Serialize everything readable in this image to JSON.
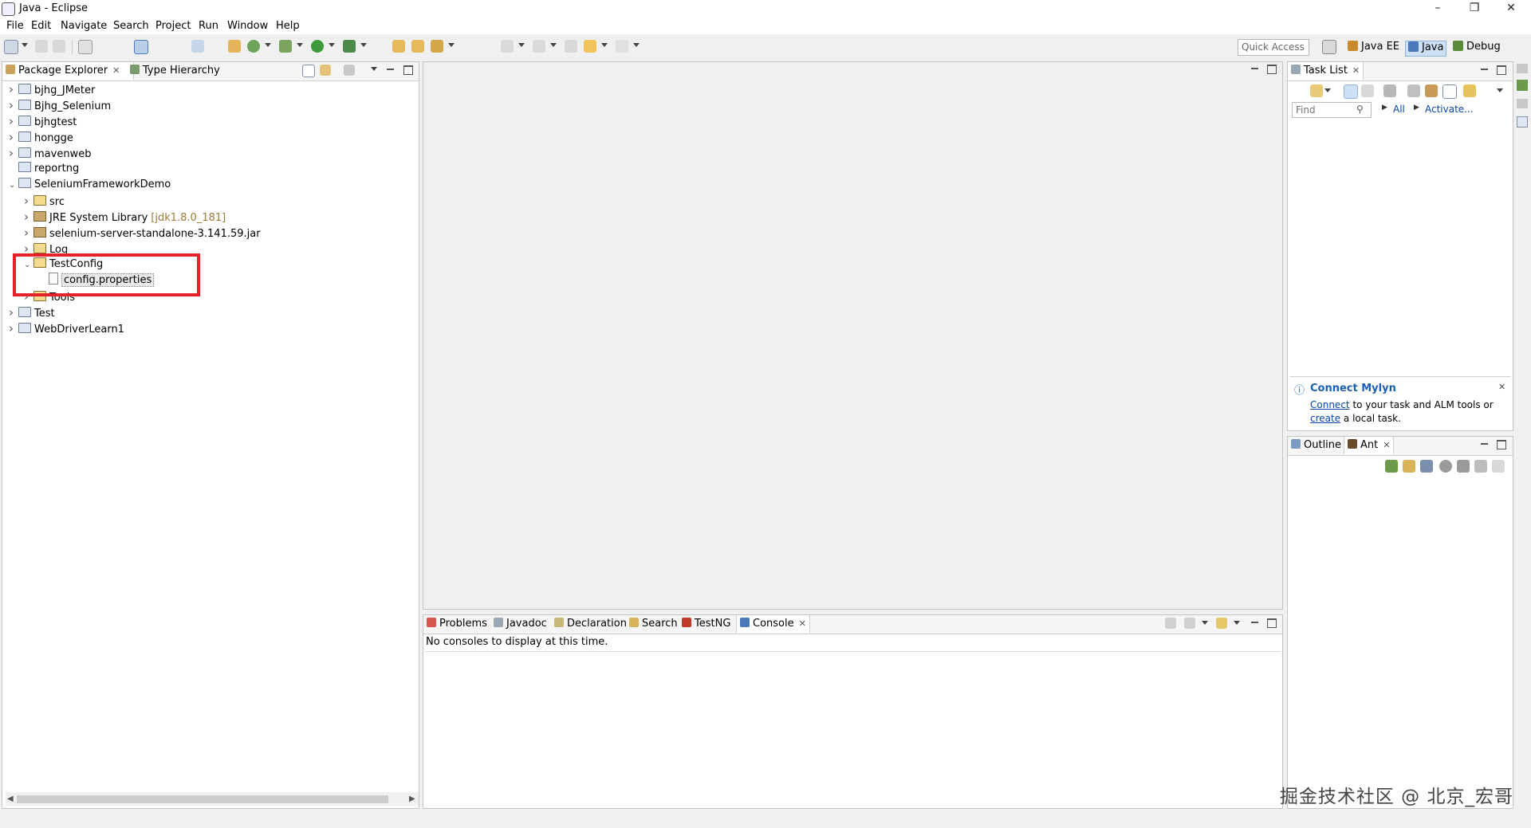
{
  "window": {
    "title": "Java - Eclipse",
    "minimize": "–",
    "restore": "❐",
    "close": "✕"
  },
  "menu": [
    "File",
    "Edit",
    "Navigate",
    "Search",
    "Project",
    "Run",
    "Window",
    "Help"
  ],
  "toolbar": {
    "quick_access": "Quick Access"
  },
  "perspectives": [
    {
      "label": "Java EE",
      "icon": "java-ee-icon",
      "color": "#c98a2a"
    },
    {
      "label": "Java",
      "icon": "java-icon",
      "color": "#4a78b8",
      "active": true
    },
    {
      "label": "Debug",
      "icon": "bug-icon",
      "color": "#5a8a3a"
    }
  ],
  "package_explorer": {
    "tabs": [
      {
        "label": "Package Explorer"
      },
      {
        "label": "Type Hierarchy"
      }
    ],
    "tree": [
      {
        "label": "bjhg_JMeter",
        "level": 0,
        "expanded": false,
        "icon": "project"
      },
      {
        "label": "Bjhg_Selenium",
        "level": 0,
        "expanded": false,
        "icon": "project"
      },
      {
        "label": "bjhgtest",
        "level": 0,
        "expanded": false,
        "icon": "project"
      },
      {
        "label": "hongge",
        "level": 0,
        "expanded": false,
        "icon": "project"
      },
      {
        "label": "mavenweb",
        "level": 0,
        "expanded": false,
        "icon": "project"
      },
      {
        "label": "reportng",
        "level": 0,
        "expanded": null,
        "icon": "project"
      },
      {
        "label": "SeleniumFrameworkDemo",
        "level": 0,
        "expanded": true,
        "icon": "project"
      },
      {
        "label": "src",
        "level": 1,
        "expanded": false,
        "icon": "folder"
      },
      {
        "label": "JRE System Library",
        "suffix": "[jdk1.8.0_181]",
        "level": 1,
        "expanded": false,
        "icon": "library"
      },
      {
        "label": "selenium-server-standalone-3.141.59.jar",
        "level": 1,
        "expanded": false,
        "icon": "jar"
      },
      {
        "label": "Log",
        "level": 1,
        "expanded": false,
        "icon": "folder"
      },
      {
        "label": "TestConfig",
        "level": 1,
        "expanded": true,
        "icon": "folder"
      },
      {
        "label": "config.properties",
        "level": 2,
        "expanded": null,
        "icon": "file",
        "selected": true
      },
      {
        "label": "Tools",
        "level": 1,
        "expanded": false,
        "icon": "folder"
      },
      {
        "label": "Test",
        "level": 0,
        "expanded": false,
        "icon": "project"
      },
      {
        "label": "WebDriverLearn1",
        "level": 0,
        "expanded": false,
        "icon": "project"
      }
    ]
  },
  "console_panel": {
    "tabs": [
      {
        "label": "Problems",
        "icon": "problems-icon"
      },
      {
        "label": "Javadoc",
        "icon": "at-icon"
      },
      {
        "label": "Declaration",
        "icon": "declaration-icon"
      },
      {
        "label": "Search",
        "icon": "search-icon"
      },
      {
        "label": "TestNG",
        "icon": "testng-icon"
      },
      {
        "label": "Console",
        "icon": "console-icon",
        "active": true
      }
    ],
    "message": "No consoles to display at this time."
  },
  "task_list": {
    "tab": "Task List",
    "find_placeholder": "Find",
    "all": "All",
    "activate": "Activate...",
    "mylyn_title": "Connect Mylyn",
    "mylyn_connect": "Connect",
    "mylyn_text1": " to your task and ALM tools or",
    "mylyn_create": "create",
    "mylyn_text2": " a local task."
  },
  "outline_panel": {
    "tabs": [
      {
        "label": "Outline"
      },
      {
        "label": "Ant"
      }
    ]
  },
  "watermark": "掘金技术社区 @ 北京_宏哥"
}
